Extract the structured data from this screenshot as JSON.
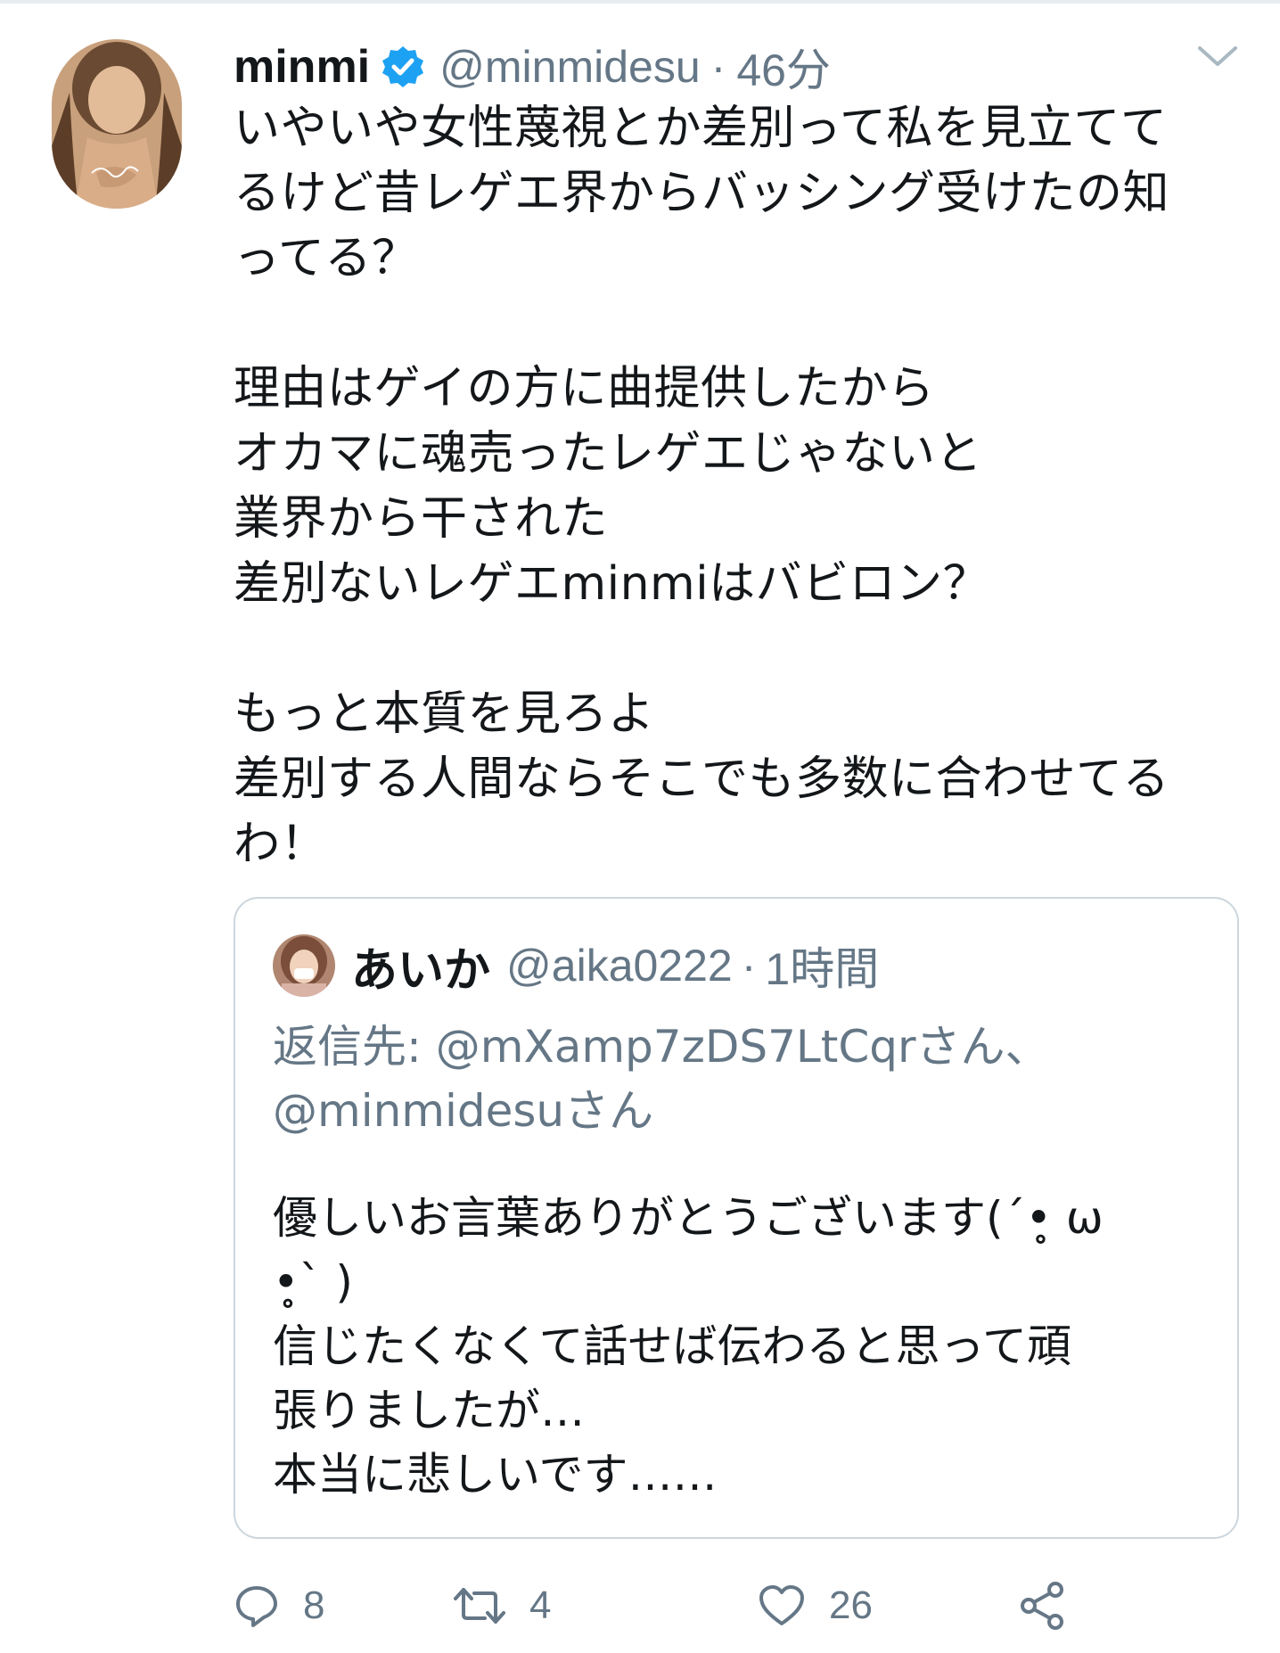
{
  "tweet": {
    "author_name": "minmi",
    "handle": "@minmidesu",
    "separator": "·",
    "time": "46分",
    "text": "いやいや女性蔑視とか差別って私を見立てて\nるけど昔レゲエ界からバッシング受けたの知\nってる？\n\n理由はゲイの方に曲提供したから\nオカマに魂売ったレゲエじゃないと\n業界から干された\n差別ないレゲエminmiはバビロン？\n\nもっと本質を見ろよ\n差別する人間ならそこでも多数に合わせてる\nわ！"
  },
  "quoted_tweet": {
    "author_name": "あいか",
    "handle": "@aika0222",
    "separator": "·",
    "time": "1時間",
    "reply_to": "返信先: @mXamp7zDS7LtCqrさん、\n@minmidesuさん",
    "text": "優しいお言葉ありがとうございます(´•̥ ω\n•̥` )\n信じたくなくて話せば伝わると思って頑\n張りましたが…\n本当に悲しいです……"
  },
  "actions": {
    "reply_count": "8",
    "retweet_count": "4",
    "like_count": "26"
  },
  "icons": {
    "verified": "verified-badge-icon",
    "menu": "chevron-down-icon",
    "reply": "reply-icon",
    "retweet": "retweet-icon",
    "like": "heart-icon",
    "share": "share-icon"
  },
  "colors": {
    "text": "#14171a",
    "secondary": "#657786",
    "verified": "#1da1f2",
    "border": "#ccd6dd"
  }
}
